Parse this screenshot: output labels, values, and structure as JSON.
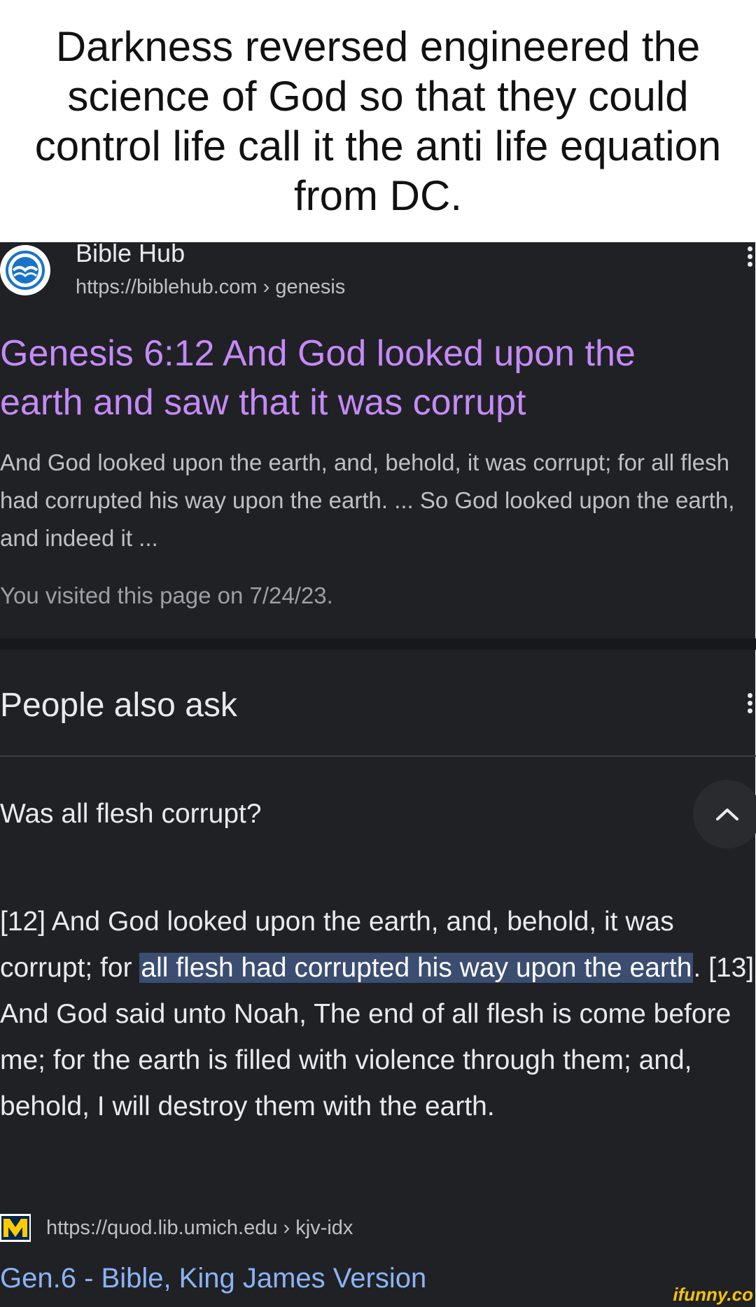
{
  "caption": {
    "text": "Darkness reversed engineered the science of God so that they could control life call it the anti life equation from DC."
  },
  "result": {
    "site_name": "Bible Hub",
    "site_url": "https://biblehub.com › genesis",
    "favicon_icon": "bible-hub-logo-icon",
    "title": "Genesis 6:12 And God looked upon the earth and saw that it was corrupt",
    "snippet": "And God looked upon the earth, and, behold, it was corrupt; for all flesh had corrupted his way upon the earth. ... So God looked upon the earth, and indeed it ...",
    "visited": "You visited this page on 7/24/23."
  },
  "people_also_ask": {
    "heading": "People also ask",
    "question": "Was all flesh corrupt?",
    "answer_before": "[12] And God looked upon the earth, and, behold, it was corrupt; for ",
    "answer_highlight": "all flesh had corrupted his way upon the earth",
    "answer_after": ". [13] And God said unto Noah, The end of all flesh is come before me; for the earth is filled with violence through them; and, behold, I will destroy them with the earth.",
    "source_url": "https://quod.lib.umich.edu › kjv-idx",
    "source_title": "Gen.6 - Bible, King James Version",
    "source_icon": "university-of-michigan-logo-icon"
  },
  "watermark": "ifunny.co",
  "colors": {
    "background": "#202124",
    "title_visited": "#c58af9",
    "link": "#8ab4f8",
    "highlight": "#3b4d70"
  }
}
